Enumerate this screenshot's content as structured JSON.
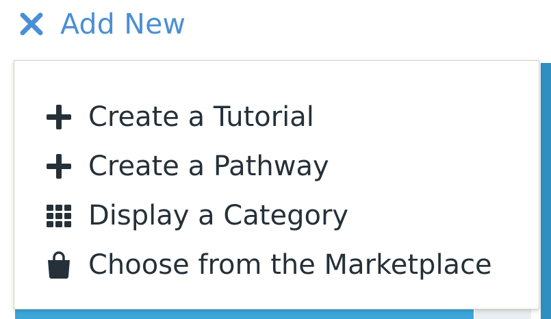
{
  "toggle": {
    "icon": "close-icon",
    "label": "Add New"
  },
  "menu": {
    "items": [
      {
        "icon": "plus-icon",
        "label": "Create a Tutorial"
      },
      {
        "icon": "plus-icon",
        "label": "Create a Pathway"
      },
      {
        "icon": "grid-icon",
        "label": "Display a Category"
      },
      {
        "icon": "shopping-bag-icon",
        "label": "Choose from the Marketplace"
      }
    ]
  },
  "colors": {
    "accent": "#4a8fd4",
    "menu_text": "#253038",
    "background_panel": "#3aa6d9"
  }
}
